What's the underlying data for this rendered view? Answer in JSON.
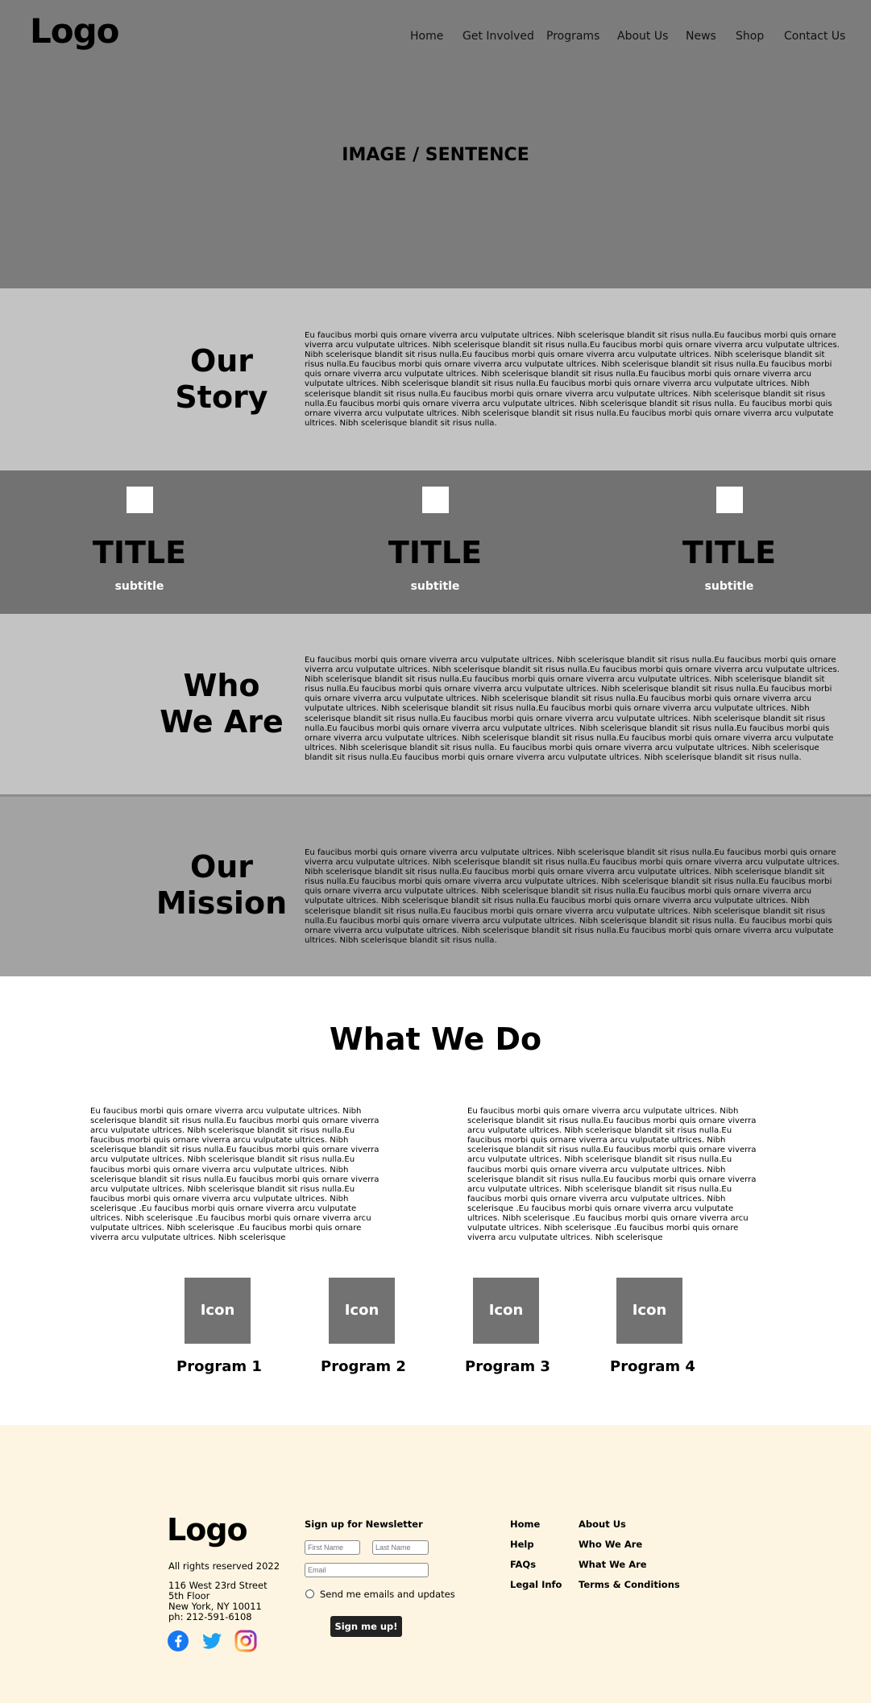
{
  "header": {
    "logo": "Logo",
    "nav": [
      "Home",
      "Get Involved",
      "Programs",
      "About Us",
      "News",
      "Shop",
      "Contact Us"
    ]
  },
  "hero": {
    "text": "IMAGE / SENTENCE"
  },
  "our_story": {
    "title_line1": "Our",
    "title_line2": "Story",
    "body": "Eu faucibus morbi quis ornare viverra arcu vulputate ultrices. Nibh scelerisque blandit sit risus nulla.Eu faucibus morbi quis ornare viverra arcu vulputate ultrices. Nibh scelerisque blandit sit risus nulla.Eu faucibus morbi quis ornare viverra arcu vulputate ultrices. Nibh scelerisque blandit sit risus nulla.Eu faucibus morbi quis ornare viverra arcu vulputate ultrices. Nibh scelerisque blandit sit risus nulla.Eu faucibus morbi quis ornare viverra arcu vulputate ultrices. Nibh scelerisque blandit sit risus nulla.Eu faucibus morbi quis ornare viverra arcu vulputate ultrices. Nibh scelerisque blandit sit risus nulla.Eu faucibus morbi quis ornare viverra arcu vulputate ultrices. Nibh scelerisque blandit sit risus nulla.Eu faucibus morbi quis ornare viverra arcu vulputate ultrices. Nibh scelerisque blandit sit risus nulla.Eu faucibus morbi quis ornare viverra arcu vulputate ultrices. Nibh scelerisque blandit sit risus nulla.Eu faucibus morbi quis ornare viverra arcu vulputate ultrices. Nibh scelerisque blandit sit risus nulla. Eu faucibus morbi quis ornare viverra arcu vulputate ultrices. Nibh scelerisque blandit sit risus nulla.Eu faucibus morbi quis ornare viverra arcu vulputate ultrices. Nibh scelerisque blandit sit risus nulla."
  },
  "features": [
    {
      "title": "TITLE",
      "subtitle": "subtitle"
    },
    {
      "title": "TITLE",
      "subtitle": "subtitle"
    },
    {
      "title": "TITLE",
      "subtitle": "subtitle"
    }
  ],
  "who_we_are": {
    "title_line1": "Who",
    "title_line2": "We Are",
    "body": "Eu faucibus morbi quis ornare viverra arcu vulputate ultrices. Nibh scelerisque blandit sit risus nulla.Eu faucibus morbi quis ornare viverra arcu vulputate ultrices. Nibh scelerisque blandit sit risus nulla.Eu faucibus morbi quis ornare viverra arcu vulputate ultrices. Nibh scelerisque blandit sit risus nulla.Eu faucibus morbi quis ornare viverra arcu vulputate ultrices. Nibh scelerisque blandit sit risus nulla.Eu faucibus morbi quis ornare viverra arcu vulputate ultrices. Nibh scelerisque blandit sit risus nulla.Eu faucibus morbi quis ornare viverra arcu vulputate ultrices. Nibh scelerisque blandit sit risus nulla.Eu faucibus morbi quis ornare viverra arcu vulputate ultrices. Nibh scelerisque blandit sit risus nulla.Eu faucibus morbi quis ornare viverra arcu vulputate ultrices. Nibh scelerisque blandit sit risus nulla.Eu faucibus morbi quis ornare viverra arcu vulputate ultrices. Nibh scelerisque blandit sit risus nulla.Eu faucibus morbi quis ornare viverra arcu vulputate ultrices. Nibh scelerisque blandit sit risus nulla.Eu faucibus morbi quis ornare viverra arcu vulputate ultrices. Nibh scelerisque blandit sit risus nulla.Eu faucibus morbi quis ornare viverra arcu vulputate ultrices. Nibh scelerisque blandit sit risus nulla. Eu faucibus morbi quis ornare viverra arcu vulputate ultrices. Nibh scelerisque blandit sit risus nulla.Eu faucibus morbi quis ornare viverra arcu vulputate ultrices. Nibh scelerisque blandit sit risus nulla."
  },
  "our_mission": {
    "title_line1": "Our",
    "title_line2": "Mission",
    "body": "Eu faucibus morbi quis ornare viverra arcu vulputate ultrices. Nibh scelerisque blandit sit risus nulla.Eu faucibus morbi quis ornare viverra arcu vulputate ultrices. Nibh scelerisque blandit sit risus nulla.Eu faucibus morbi quis ornare viverra arcu vulputate ultrices. Nibh scelerisque blandit sit risus nulla.Eu faucibus morbi quis ornare viverra arcu vulputate ultrices. Nibh scelerisque blandit sit risus nulla.Eu faucibus morbi quis ornare viverra arcu vulputate ultrices. Nibh scelerisque blandit sit risus nulla.Eu faucibus morbi quis ornare viverra arcu vulputate ultrices. Nibh scelerisque blandit sit risus nulla.Eu faucibus morbi quis ornare viverra arcu vulputate ultrices. Nibh scelerisque blandit sit risus nulla.Eu faucibus morbi quis ornare viverra arcu vulputate ultrices. Nibh scelerisque blandit sit risus nulla.Eu faucibus morbi quis ornare viverra arcu vulputate ultrices. Nibh scelerisque blandit sit risus nulla.Eu faucibus morbi quis ornare viverra arcu vulputate ultrices. Nibh scelerisque blandit sit risus nulla. Eu faucibus morbi quis ornare viverra arcu vulputate ultrices. Nibh scelerisque blandit sit risus nulla.Eu faucibus morbi quis ornare viverra arcu vulputate ultrices. Nibh scelerisque blandit sit risus nulla."
  },
  "what_we_do": {
    "title": "What We Do",
    "col1": "Eu faucibus morbi quis ornare viverra arcu vulputate ultrices. Nibh scelerisque blandit sit risus nulla.Eu faucibus morbi quis ornare viverra arcu vulputate ultrices. Nibh scelerisque blandit sit risus nulla.Eu faucibus morbi quis ornare viverra arcu vulputate ultrices. Nibh scelerisque blandit sit risus nulla.Eu faucibus morbi quis ornare viverra arcu vulputate ultrices. Nibh scelerisque blandit sit risus nulla.Eu faucibus morbi quis ornare viverra arcu vulputate ultrices. Nibh scelerisque blandit sit risus nulla.Eu faucibus morbi quis ornare viverra arcu vulputate ultrices. Nibh scelerisque blandit sit risus nulla.Eu faucibus morbi quis ornare viverra arcu vulputate ultrices. Nibh scelerisque .Eu faucibus morbi quis ornare viverra arcu vulputate ultrices. Nibh scelerisque .Eu faucibus morbi quis ornare viverra arcu vulputate ultrices. Nibh scelerisque .Eu faucibus morbi quis ornare viverra arcu vulputate ultrices. Nibh scelerisque",
    "col2": "Eu faucibus morbi quis ornare viverra arcu vulputate ultrices. Nibh scelerisque blandit sit risus nulla.Eu faucibus morbi quis ornare viverra arcu vulputate ultrices. Nibh scelerisque blandit sit risus nulla.Eu faucibus morbi quis ornare viverra arcu vulputate ultrices. Nibh scelerisque blandit sit risus nulla.Eu faucibus morbi quis ornare viverra arcu vulputate ultrices. Nibh scelerisque blandit sit risus nulla.Eu faucibus morbi quis ornare viverra arcu vulputate ultrices. Nibh scelerisque blandit sit risus nulla.Eu faucibus morbi quis ornare viverra arcu vulputate ultrices. Nibh scelerisque blandit sit risus nulla.Eu faucibus morbi quis ornare viverra arcu vulputate ultrices. Nibh scelerisque .Eu faucibus morbi quis ornare viverra arcu vulputate ultrices. Nibh scelerisque .Eu faucibus morbi quis ornare viverra arcu vulputate ultrices. Nibh scelerisque .Eu faucibus morbi quis ornare viverra arcu vulputate ultrices. Nibh scelerisque",
    "programs": [
      {
        "icon": "Icon",
        "label": "Program 1"
      },
      {
        "icon": "Icon",
        "label": "Program 2"
      },
      {
        "icon": "Icon",
        "label": "Program 3"
      },
      {
        "icon": "Icon",
        "label": "Program 4"
      }
    ]
  },
  "footer": {
    "logo": "Logo",
    "rights": "All rights reserved 2022",
    "address": [
      "116 West 23rd Street",
      "5th Floor",
      "New York, NY 10011",
      "ph: 212-591-6108"
    ],
    "social_icons": [
      "facebook-icon",
      "twitter-icon",
      "instagram-icon"
    ],
    "newsletter": {
      "title": "Sign up for Newsletter",
      "first_name_placeholder": "First Name",
      "last_name_placeholder": "Last Name",
      "email_placeholder": "Email",
      "checkbox_label": "Send me emails and updates",
      "button": "Sign me up!"
    },
    "links_col1": [
      "Home",
      "Help",
      "FAQs",
      "Legal Info"
    ],
    "links_col2": [
      "About Us",
      "Who We Are",
      "What We Are",
      "Terms & Conditions"
    ]
  },
  "colors": {
    "hero_bg": "#7c7c7c",
    "story_bg": "#c3c3c3",
    "feature_bg": "#727272",
    "mission_bg": "#a3a3a3",
    "footer_bg": "#fdf5e1",
    "button_bg": "#222222"
  }
}
